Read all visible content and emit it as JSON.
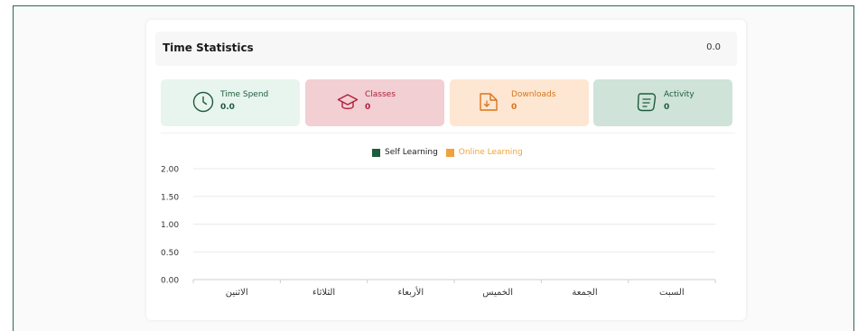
{
  "header": {
    "title": "Time Statistics",
    "total": "0.0"
  },
  "stats": [
    {
      "label": "Time Spend",
      "value": "0.0",
      "icon": "clock-icon",
      "color": "#1d5c3c"
    },
    {
      "label": "Classes",
      "value": "0",
      "icon": "graduation-cap-icon",
      "color": "#b11f3a"
    },
    {
      "label": "Downloads",
      "value": "0",
      "icon": "download-file-icon",
      "color": "#d9751a"
    },
    {
      "label": "Activity",
      "value": "0",
      "icon": "activity-icon",
      "color": "#1d5c3c"
    }
  ],
  "legend": {
    "self": {
      "label": "Self Learning",
      "color": "#1d5c3c"
    },
    "online": {
      "label": "Online Learning",
      "color": "#f0a23a"
    }
  },
  "chart_data": {
    "type": "bar",
    "categories": [
      "الاثنين",
      "الثلاثاء",
      "الأربعاء",
      "الخميس",
      "الجمعة",
      "السبت"
    ],
    "series": [
      {
        "name": "Self Learning",
        "values": [
          0,
          0,
          0,
          0,
          0,
          0
        ]
      },
      {
        "name": "Online Learning",
        "values": [
          0,
          0,
          0,
          0,
          0,
          0
        ]
      }
    ],
    "yticks": [
      "0.00",
      "0.50",
      "1.00",
      "1.50",
      "2.00"
    ],
    "ylim": [
      0,
      2
    ],
    "legend_position": "top-center",
    "grid": true
  }
}
